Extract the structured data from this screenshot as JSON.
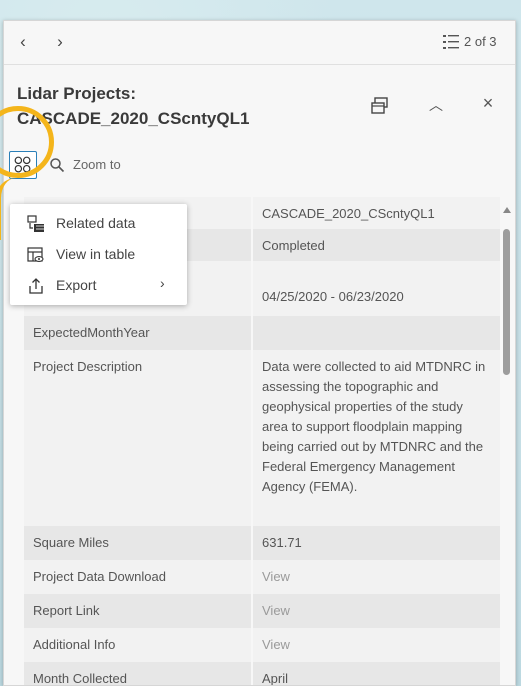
{
  "nav": {
    "prev_glyph": "‹",
    "next_glyph": "›",
    "page_count": "2 of 3"
  },
  "title": "Lidar Projects: CASCADE_2020_CScntyQL1",
  "actions": {
    "zoom_label": "Zoom to"
  },
  "menu": {
    "items": [
      {
        "label": "Related data",
        "icon": "related-data-icon"
      },
      {
        "label": "View in table",
        "icon": "table-view-icon"
      },
      {
        "label": "Export",
        "icon": "export-icon",
        "has_submenu": true
      }
    ]
  },
  "fields": [
    {
      "key": "",
      "value": "CASCADE_2020_CScntyQL1"
    },
    {
      "key": "",
      "value": "Completed"
    },
    {
      "key": "",
      "value": "04/25/2020 - 06/23/2020"
    },
    {
      "key": "ExpectedMonthYear",
      "value": ""
    },
    {
      "key": "Project Description",
      "value": "Data were collected to aid MTDNRC in assessing the topographic and geophysical properties of the study area to support floodplain mapping being carried out by MTDNRC and the Federal Emergency Management Agency (FEMA)."
    },
    {
      "key": "Square Miles",
      "value": "631.71"
    },
    {
      "key": "Project Data Download",
      "value": "View"
    },
    {
      "key": "Report Link",
      "value": "View"
    },
    {
      "key": "Additional Info",
      "value": "View"
    },
    {
      "key": "Month Collected",
      "value": "April"
    }
  ],
  "colors": {
    "highlight": "#f4b51b",
    "accent": "#2a7fb8"
  }
}
